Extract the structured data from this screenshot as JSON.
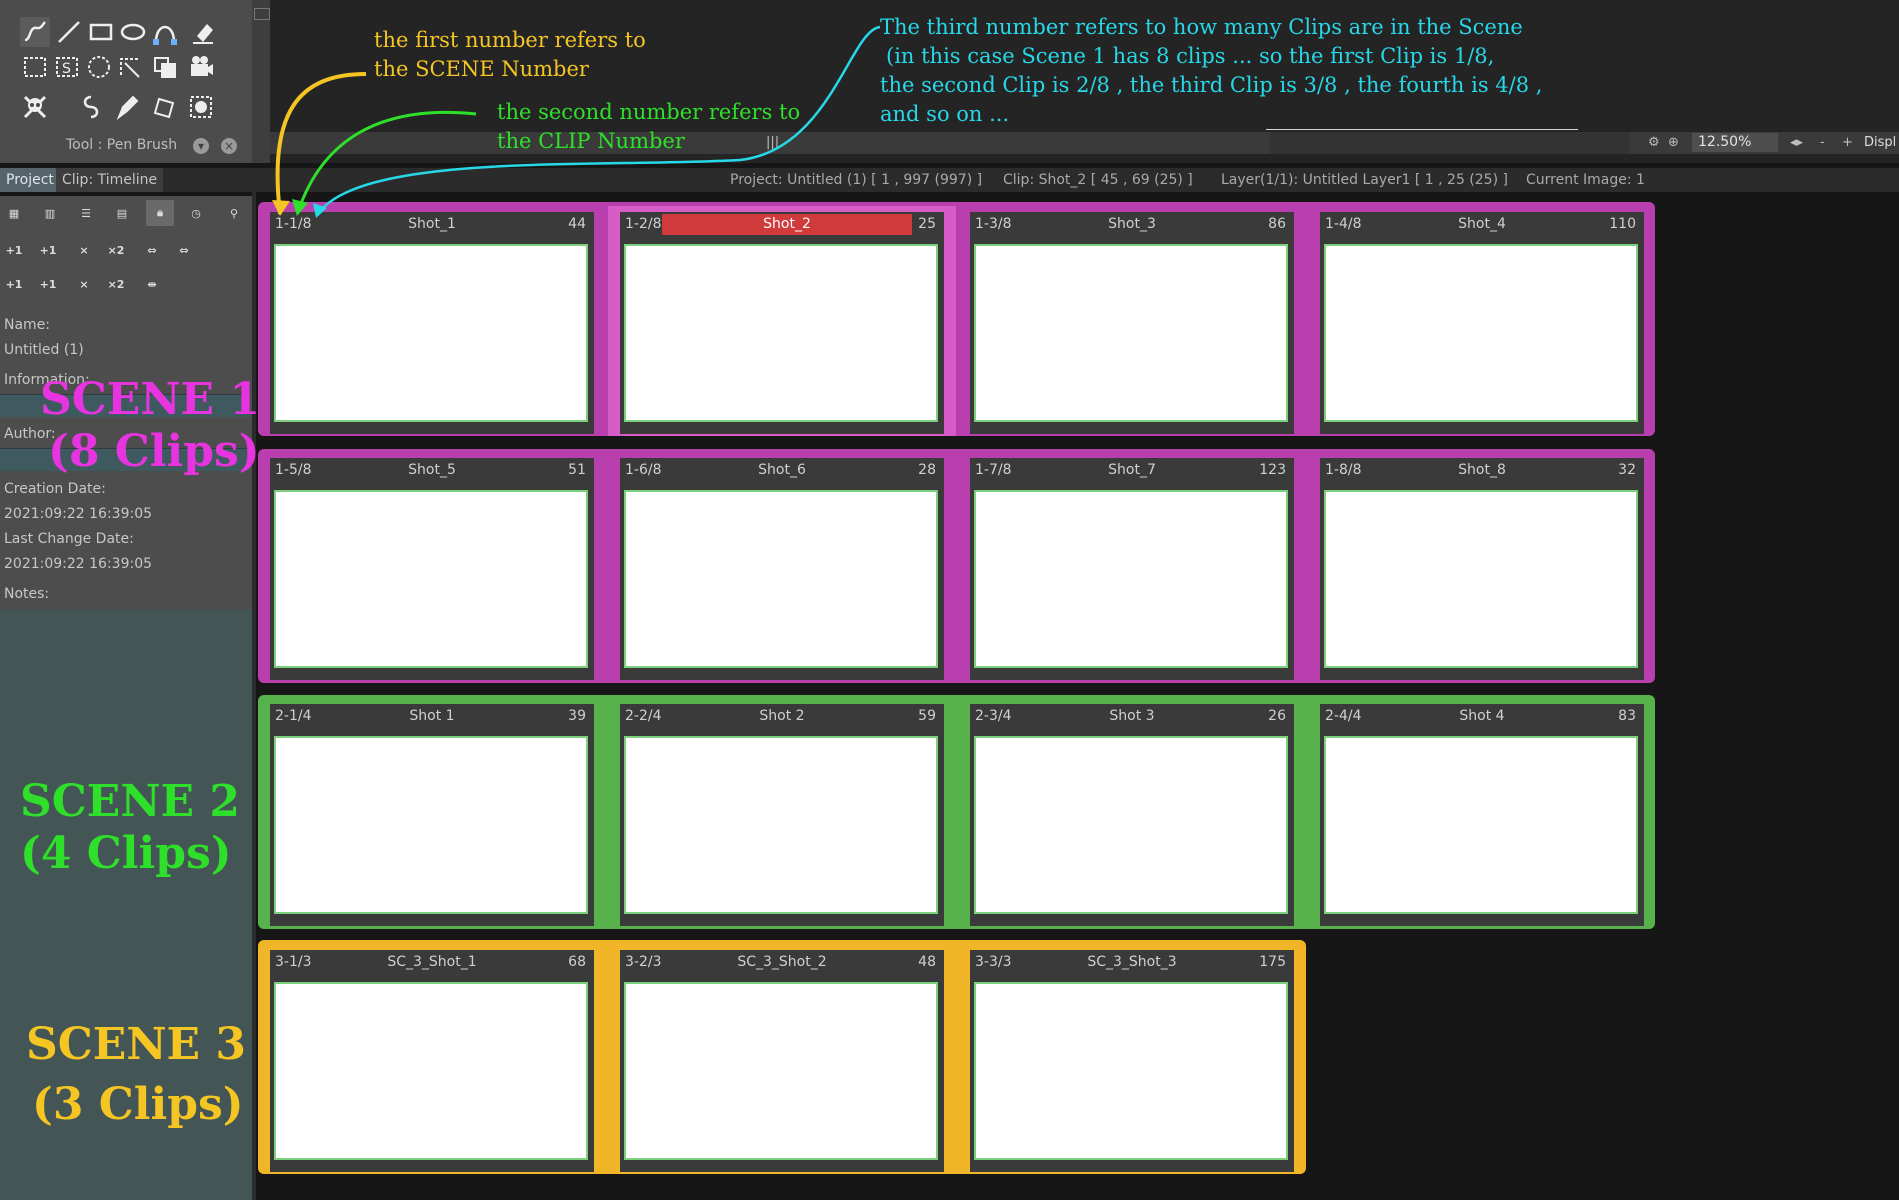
{
  "toolbox": {
    "tool_label": "Tool : Pen Brush",
    "tools": [
      "pen-brush-icon",
      "line-icon",
      "rectangle-icon",
      "ellipse-icon",
      "bezier-icon",
      "eraser-icon",
      "rect-select-icon",
      "lasso-select-icon",
      "ellipse-select-icon",
      "free-select-icon",
      "transform-icon",
      "camera-icon",
      "skull-icon",
      "magic-wand-icon",
      "pen-icon",
      "paint-bucket-icon",
      "mask-icon"
    ]
  },
  "topbar": {
    "zoom": "12.50%",
    "display_label": "Displ",
    "minus": "-",
    "plus": "+"
  },
  "tabs": {
    "project": "Project",
    "clip_timeline": "Clip: Timeline"
  },
  "status": {
    "project": "Project: Untitled (1) [ 1 , 997  (997) ]",
    "clip": "Clip: Shot_2 [ 45 , 69  (25) ]",
    "layer": "Layer(1/1): Untitled Layer1 [ 1 , 25  (25) ]",
    "current_image": "Current Image: 1"
  },
  "panel": {
    "row1_labels": [
      "+1",
      "+1",
      "×",
      "×2"
    ],
    "row2_labels": [
      "+1",
      "+1",
      "×",
      "×2"
    ],
    "name_label": "Name:",
    "name_value": "Untitled (1)",
    "information_label": "Information:",
    "author_label": "Author:",
    "creation_date_label": "Creation Date:",
    "creation_date_value": "2021:09:22 16:39:05",
    "last_change_label": "Last Change Date:",
    "last_change_value": "2021:09:22 16:39:05",
    "notes_label": "Notes:"
  },
  "scenes": [
    {
      "label_line1": "SCENE 1",
      "label_line2": "(8 Clips)",
      "color": "#b83fad"
    },
    {
      "label_line1": "SCENE 2",
      "label_line2": "(4 Clips)",
      "color": "#58b24c"
    },
    {
      "label_line1": "SCENE 3",
      "label_line2": "(3 Clips)",
      "color": "#f0b628"
    }
  ],
  "clips": [
    {
      "id": "1-1/8",
      "name": "Shot_1",
      "count": "44"
    },
    {
      "id": "1-2/8",
      "name": "Shot_2",
      "count": "25",
      "selected": true
    },
    {
      "id": "1-3/8",
      "name": "Shot_3",
      "count": "86"
    },
    {
      "id": "1-4/8",
      "name": "Shot_4",
      "count": "110"
    },
    {
      "id": "1-5/8",
      "name": "Shot_5",
      "count": "51"
    },
    {
      "id": "1-6/8",
      "name": "Shot_6",
      "count": "28"
    },
    {
      "id": "1-7/8",
      "name": "Shot_7",
      "count": "123"
    },
    {
      "id": "1-8/8",
      "name": "Shot_8",
      "count": "32"
    },
    {
      "id": "2-1/4",
      "name": "Shot 1",
      "count": "39"
    },
    {
      "id": "2-2/4",
      "name": "Shot 2",
      "count": "59"
    },
    {
      "id": "2-3/4",
      "name": "Shot 3",
      "count": "26"
    },
    {
      "id": "2-4/4",
      "name": "Shot 4",
      "count": "83"
    },
    {
      "id": "3-1/3",
      "name": "SC_3_Shot_1",
      "count": "68"
    },
    {
      "id": "3-2/3",
      "name": "SC_3_Shot_2",
      "count": "48"
    },
    {
      "id": "3-3/3",
      "name": "SC_3_Shot_3",
      "count": "175"
    }
  ],
  "annotations": {
    "first_line1": "the first number refers to",
    "first_line2": "the SCENE Number",
    "second_line1": "the second number refers to",
    "second_line2": "the CLIP Number",
    "third_line1": "The third number refers to how many Clips are in the Scene",
    "third_line2": "(in this case Scene 1 has 8 clips ... so the first Clip is 1/8,",
    "third_line3": "the second Clip is 2/8 , the third Clip is 3/8 , the fourth is 4/8 ,",
    "third_line4": "and so on ...",
    "colors": {
      "first": "#f5c523",
      "second": "#2fe02a",
      "third": "#27d8e8"
    }
  }
}
